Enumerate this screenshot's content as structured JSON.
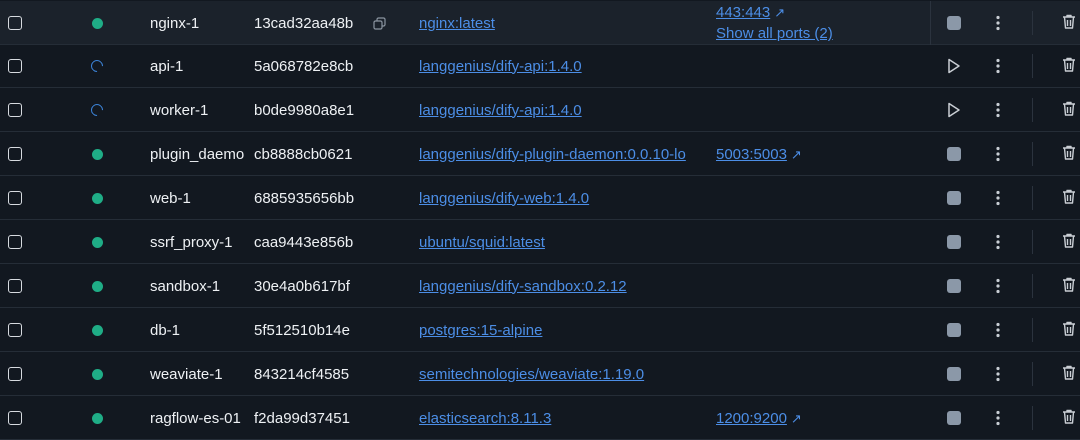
{
  "copy_icon": "copy-icon",
  "external_icon": "↗",
  "colors": {
    "running": "#1fad86",
    "starting": "#3b82d6",
    "link": "#4c8ee6"
  },
  "rows": [
    {
      "name": "nginx-1",
      "id": "13cad32aa48b",
      "image": "nginx:latest",
      "ports": [
        "443:443"
      ],
      "ports_more": "Show all ports (2)",
      "status": "running",
      "action": "stop",
      "show_copy": true
    },
    {
      "name": "api-1",
      "id": "5a068782e8cb",
      "image": "langgenius/dify-api:1.4.0",
      "ports": [],
      "status": "starting",
      "action": "start"
    },
    {
      "name": "worker-1",
      "id": "b0de9980a8e1",
      "image": "langgenius/dify-api:1.4.0",
      "ports": [],
      "status": "starting",
      "action": "start"
    },
    {
      "name": "plugin_daemo",
      "id": "cb8888cb0621",
      "image": "langgenius/dify-plugin-daemon:0.0.10-lo",
      "ports": [
        "5003:5003"
      ],
      "status": "running",
      "action": "stop"
    },
    {
      "name": "web-1",
      "id": "6885935656bb",
      "image": "langgenius/dify-web:1.4.0",
      "ports": [],
      "status": "running",
      "action": "stop"
    },
    {
      "name": "ssrf_proxy-1",
      "id": "caa9443e856b",
      "image": "ubuntu/squid:latest",
      "ports": [],
      "status": "running",
      "action": "stop"
    },
    {
      "name": "sandbox-1",
      "id": "30e4a0b617bf",
      "image": "langgenius/dify-sandbox:0.2.12",
      "ports": [],
      "status": "running",
      "action": "stop"
    },
    {
      "name": "db-1",
      "id": "5f512510b14e",
      "image": "postgres:15-alpine",
      "ports": [],
      "status": "running",
      "action": "stop"
    },
    {
      "name": "weaviate-1",
      "id": "843214cf4585",
      "image": "semitechnologies/weaviate:1.19.0",
      "ports": [],
      "status": "running",
      "action": "stop"
    },
    {
      "name": "ragflow-es-01",
      "id": "f2da99d37451",
      "image": "elasticsearch:8.11.3",
      "ports": [
        "1200:9200"
      ],
      "status": "running",
      "action": "stop"
    }
  ]
}
